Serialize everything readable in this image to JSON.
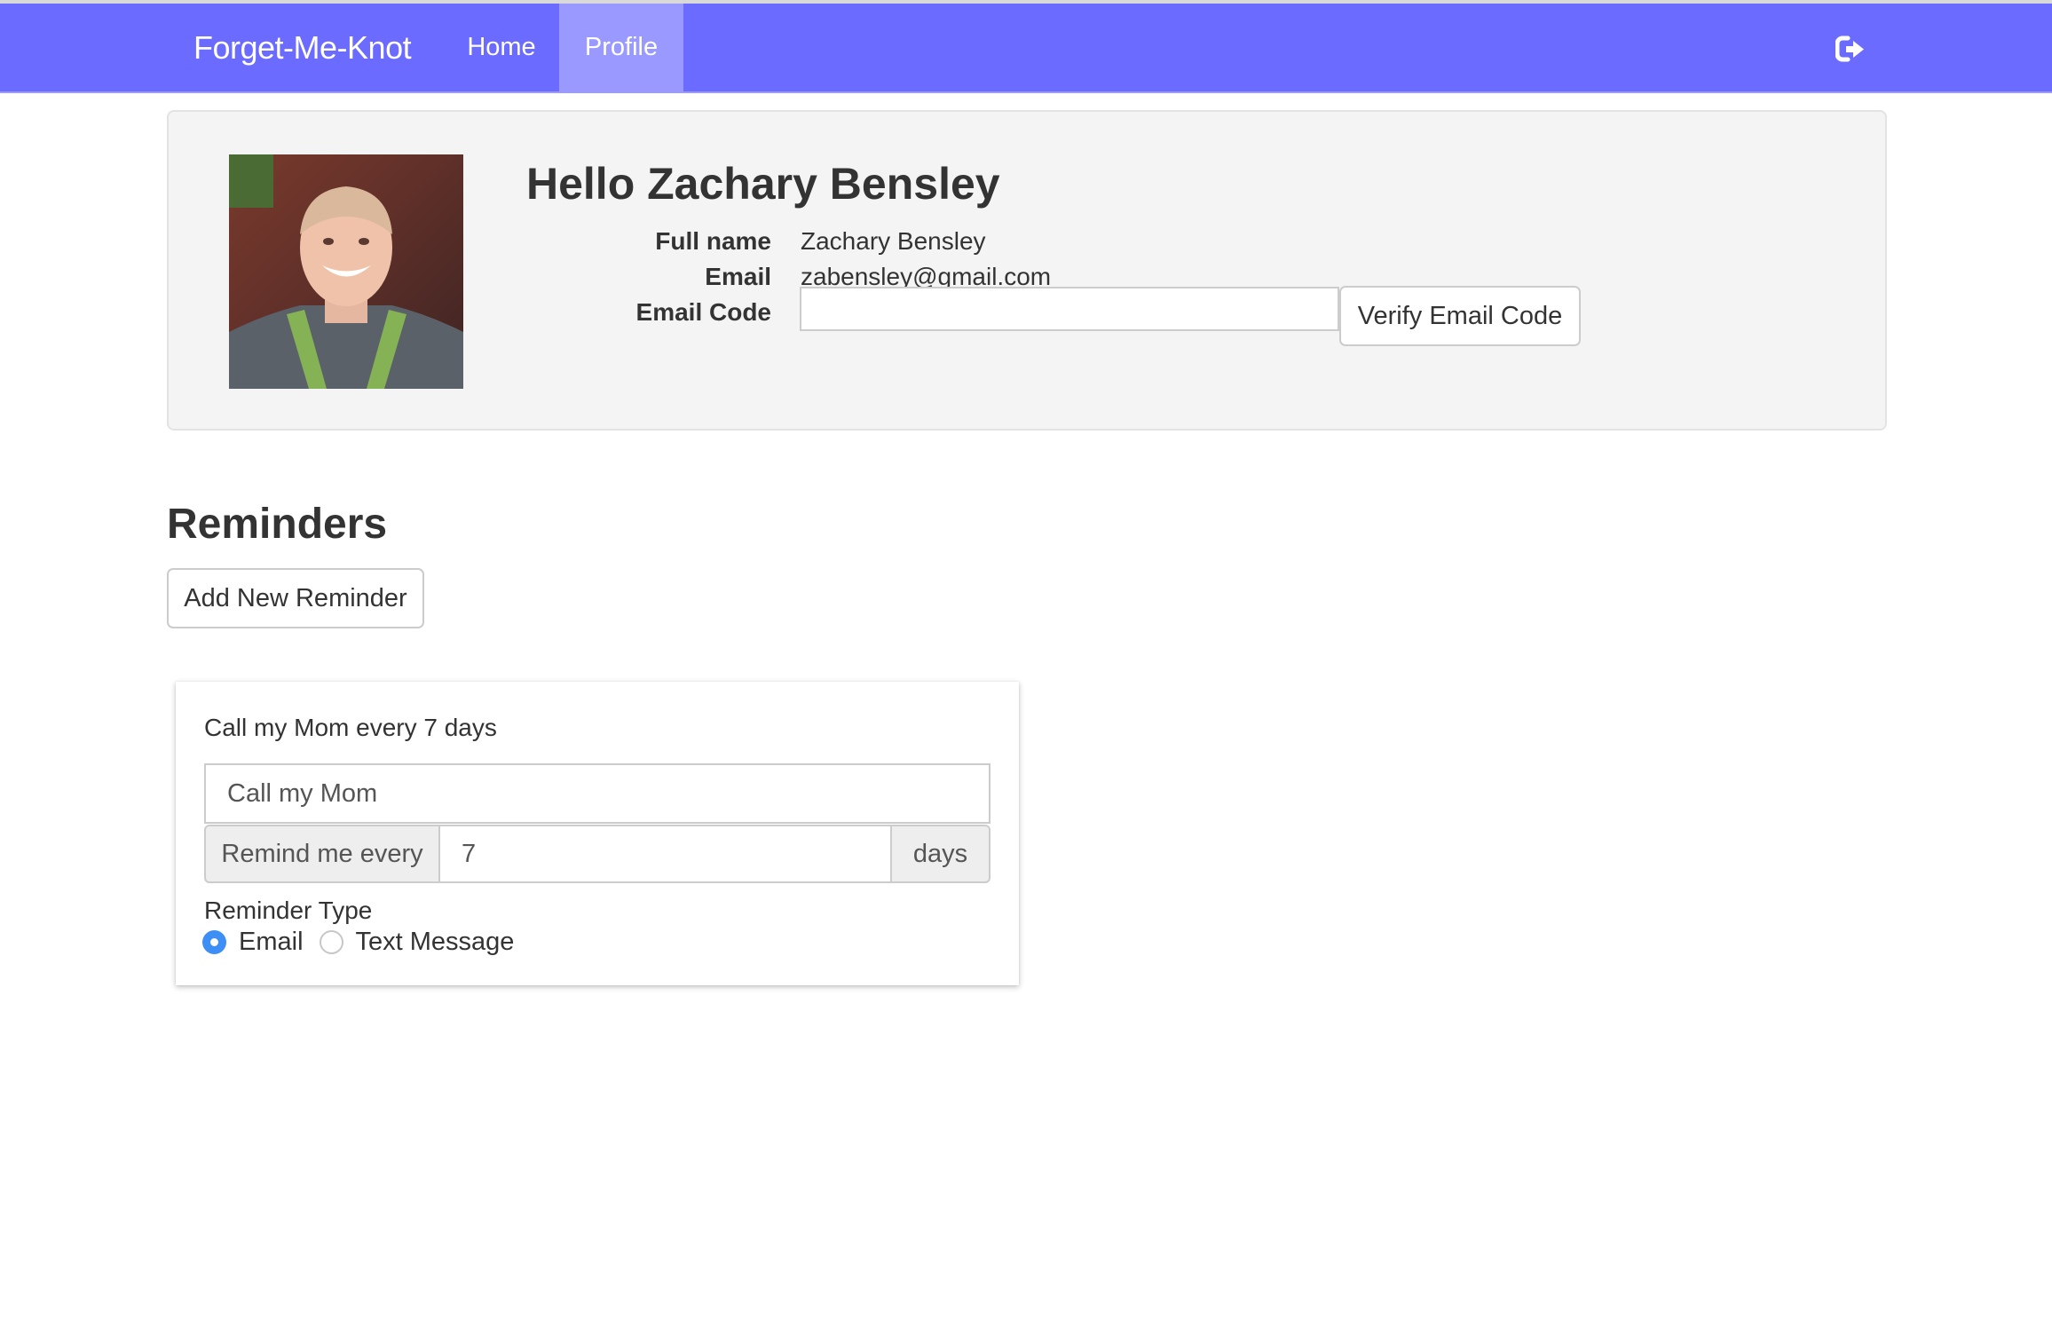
{
  "navbar": {
    "brand": "Forget-Me-Knot",
    "links": [
      {
        "label": "Home",
        "active": false
      },
      {
        "label": "Profile",
        "active": true
      }
    ],
    "logout_icon": "sign-out-icon",
    "colors": {
      "bar": "#6b6bff",
      "active": "#9999ff"
    }
  },
  "profile": {
    "greeting": "Hello Zachary Bensley",
    "avatar_alt": "Profile photo",
    "fields": [
      {
        "label": "Full name",
        "value": "Zachary Bensley"
      },
      {
        "label": "Email",
        "value": "zabensley@gmail.com"
      },
      {
        "label": "Email Code",
        "value": ""
      }
    ],
    "email_code_placeholder": "",
    "verify_button": "Verify Email Code"
  },
  "reminders": {
    "title": "Reminders",
    "add_button": "Add New Reminder",
    "items": [
      {
        "summary": "Call my Mom every 7 days",
        "name": "Call my Mom",
        "interval_prefix": "Remind me every",
        "interval_value": "7",
        "interval_suffix": "days",
        "type_label": "Reminder Type",
        "types": [
          {
            "label": "Email",
            "checked": true
          },
          {
            "label": "Text Message",
            "checked": false
          }
        ]
      }
    ]
  }
}
